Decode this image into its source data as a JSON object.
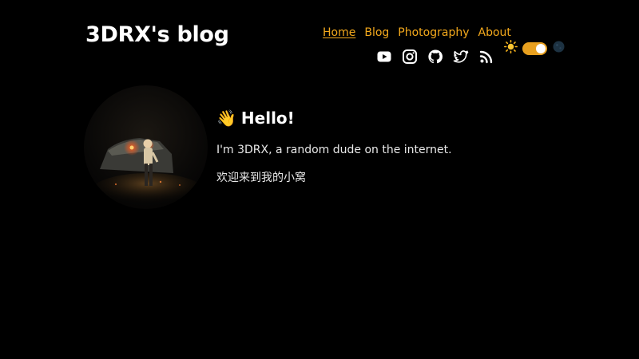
{
  "site": {
    "title": "3DRX's blog"
  },
  "nav": {
    "items": [
      {
        "label": "Home",
        "active": true
      },
      {
        "label": "Blog",
        "active": false
      },
      {
        "label": "Photography",
        "active": false
      },
      {
        "label": "About",
        "active": false
      }
    ]
  },
  "socials": [
    "youtube-icon",
    "instagram-icon",
    "github-icon",
    "twitter-icon",
    "rss-icon"
  ],
  "theme_toggle": {
    "left_icon": "sun-icon",
    "right_icon": "moon-icon",
    "state": "light"
  },
  "intro": {
    "greeting": "Hello!",
    "greeting_emoji": "👋",
    "line1": "I'm 3DRX, a random dude on the internet.",
    "line2": "欢迎来到我的小窝"
  },
  "colors": {
    "background": "#000000",
    "accent": "#f4a91c",
    "text": "#ffffff"
  }
}
